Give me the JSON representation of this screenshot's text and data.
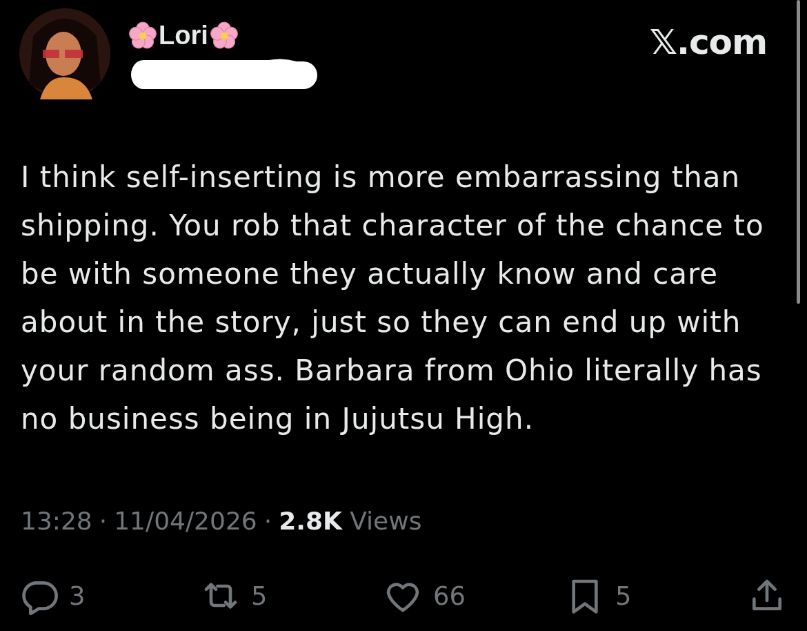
{
  "author": {
    "name": "Lori",
    "site": "𝕏.com"
  },
  "text": "I think self-inserting is more embarrassing than shipping. You rob that character of the chance to be with someone they actually know and care about in the story, just so they can end up with your random ass. Barbara from Ohio literally has no business being in Jujutsu High.",
  "meta": {
    "time": "13:28",
    "separator_1": "·",
    "date": "11/04/2026",
    "separator_2": "·",
    "views_count": "2.8K",
    "views_label": "Views"
  },
  "actions": [
    {
      "kind": "reply",
      "count": "3"
    },
    {
      "kind": "repost",
      "count": "5"
    },
    {
      "kind": "like",
      "count": "66"
    },
    {
      "kind": "bookmark",
      "count": "5"
    },
    {
      "kind": "share"
    }
  ]
}
